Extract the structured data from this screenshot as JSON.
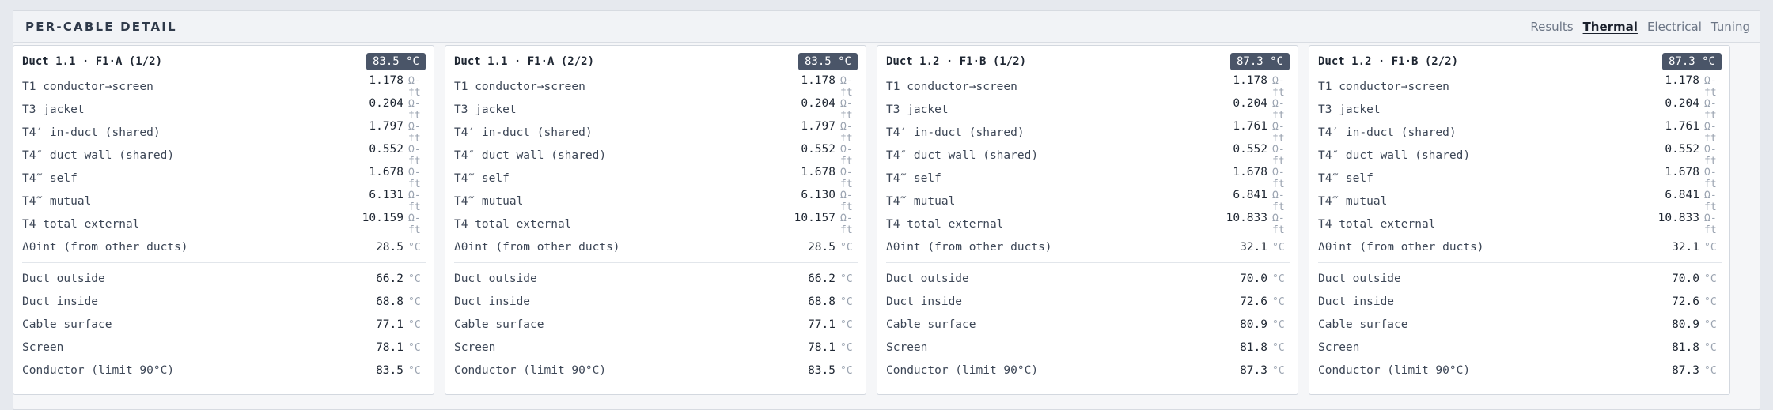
{
  "panel": {
    "title": "PER-CABLE DETAIL",
    "tabs": [
      "Results",
      "Thermal",
      "Electrical",
      "Tuning"
    ],
    "active_tab": "Thermal"
  },
  "cards": [
    {
      "title": "Duct 1.1 · F1·A (1/2)",
      "temp": "83.5 °C",
      "resist_rows": [
        {
          "label": "T1 conductor→screen",
          "value": "1.178",
          "unit": "Ω-ft"
        },
        {
          "label": "T3 jacket",
          "value": "0.204",
          "unit": "Ω-ft"
        },
        {
          "label": "T4′ in-duct (shared)",
          "value": "1.797",
          "unit": "Ω-ft"
        },
        {
          "label": "T4″ duct wall (shared)",
          "value": "0.552",
          "unit": "Ω-ft"
        },
        {
          "label": "T4‴ self",
          "value": "1.678",
          "unit": "Ω-ft"
        },
        {
          "label": "T4‴ mutual",
          "value": "6.131",
          "unit": "Ω-ft"
        },
        {
          "label": "T4 total external",
          "value": "10.159",
          "unit": "Ω-ft"
        },
        {
          "label": "Δθint (from other ducts)",
          "value": "28.5",
          "unit": "°C"
        }
      ],
      "temp_rows": [
        {
          "label": "Duct outside",
          "value": "66.2",
          "unit": "°C"
        },
        {
          "label": "Duct inside",
          "value": "68.8",
          "unit": "°C"
        },
        {
          "label": "Cable surface",
          "value": "77.1",
          "unit": "°C"
        },
        {
          "label": "Screen",
          "value": "78.1",
          "unit": "°C"
        },
        {
          "label": "Conductor (limit 90°C)",
          "value": "83.5",
          "unit": "°C"
        }
      ]
    },
    {
      "title": "Duct 1.1 · F1·A (2/2)",
      "temp": "83.5 °C",
      "resist_rows": [
        {
          "label": "T1 conductor→screen",
          "value": "1.178",
          "unit": "Ω-ft"
        },
        {
          "label": "T3 jacket",
          "value": "0.204",
          "unit": "Ω-ft"
        },
        {
          "label": "T4′ in-duct (shared)",
          "value": "1.797",
          "unit": "Ω-ft"
        },
        {
          "label": "T4″ duct wall (shared)",
          "value": "0.552",
          "unit": "Ω-ft"
        },
        {
          "label": "T4‴ self",
          "value": "1.678",
          "unit": "Ω-ft"
        },
        {
          "label": "T4‴ mutual",
          "value": "6.130",
          "unit": "Ω-ft"
        },
        {
          "label": "T4 total external",
          "value": "10.157",
          "unit": "Ω-ft"
        },
        {
          "label": "Δθint (from other ducts)",
          "value": "28.5",
          "unit": "°C"
        }
      ],
      "temp_rows": [
        {
          "label": "Duct outside",
          "value": "66.2",
          "unit": "°C"
        },
        {
          "label": "Duct inside",
          "value": "68.8",
          "unit": "°C"
        },
        {
          "label": "Cable surface",
          "value": "77.1",
          "unit": "°C"
        },
        {
          "label": "Screen",
          "value": "78.1",
          "unit": "°C"
        },
        {
          "label": "Conductor (limit 90°C)",
          "value": "83.5",
          "unit": "°C"
        }
      ]
    },
    {
      "title": "Duct 1.2 · F1·B (1/2)",
      "temp": "87.3 °C",
      "resist_rows": [
        {
          "label": "T1 conductor→screen",
          "value": "1.178",
          "unit": "Ω-ft"
        },
        {
          "label": "T3 jacket",
          "value": "0.204",
          "unit": "Ω-ft"
        },
        {
          "label": "T4′ in-duct (shared)",
          "value": "1.761",
          "unit": "Ω-ft"
        },
        {
          "label": "T4″ duct wall (shared)",
          "value": "0.552",
          "unit": "Ω-ft"
        },
        {
          "label": "T4‴ self",
          "value": "1.678",
          "unit": "Ω-ft"
        },
        {
          "label": "T4‴ mutual",
          "value": "6.841",
          "unit": "Ω-ft"
        },
        {
          "label": "T4 total external",
          "value": "10.833",
          "unit": "Ω-ft"
        },
        {
          "label": "Δθint (from other ducts)",
          "value": "32.1",
          "unit": "°C"
        }
      ],
      "temp_rows": [
        {
          "label": "Duct outside",
          "value": "70.0",
          "unit": "°C"
        },
        {
          "label": "Duct inside",
          "value": "72.6",
          "unit": "°C"
        },
        {
          "label": "Cable surface",
          "value": "80.9",
          "unit": "°C"
        },
        {
          "label": "Screen",
          "value": "81.8",
          "unit": "°C"
        },
        {
          "label": "Conductor (limit 90°C)",
          "value": "87.3",
          "unit": "°C"
        }
      ]
    },
    {
      "title": "Duct 1.2 · F1·B (2/2)",
      "temp": "87.3 °C",
      "resist_rows": [
        {
          "label": "T1 conductor→screen",
          "value": "1.178",
          "unit": "Ω-ft"
        },
        {
          "label": "T3 jacket",
          "value": "0.204",
          "unit": "Ω-ft"
        },
        {
          "label": "T4′ in-duct (shared)",
          "value": "1.761",
          "unit": "Ω-ft"
        },
        {
          "label": "T4″ duct wall (shared)",
          "value": "0.552",
          "unit": "Ω-ft"
        },
        {
          "label": "T4‴ self",
          "value": "1.678",
          "unit": "Ω-ft"
        },
        {
          "label": "T4‴ mutual",
          "value": "6.841",
          "unit": "Ω-ft"
        },
        {
          "label": "T4 total external",
          "value": "10.833",
          "unit": "Ω-ft"
        },
        {
          "label": "Δθint (from other ducts)",
          "value": "32.1",
          "unit": "°C"
        }
      ],
      "temp_rows": [
        {
          "label": "Duct outside",
          "value": "70.0",
          "unit": "°C"
        },
        {
          "label": "Duct inside",
          "value": "72.6",
          "unit": "°C"
        },
        {
          "label": "Cable surface",
          "value": "80.9",
          "unit": "°C"
        },
        {
          "label": "Screen",
          "value": "81.8",
          "unit": "°C"
        },
        {
          "label": "Conductor (limit 90°C)",
          "value": "87.3",
          "unit": "°C"
        }
      ]
    }
  ]
}
